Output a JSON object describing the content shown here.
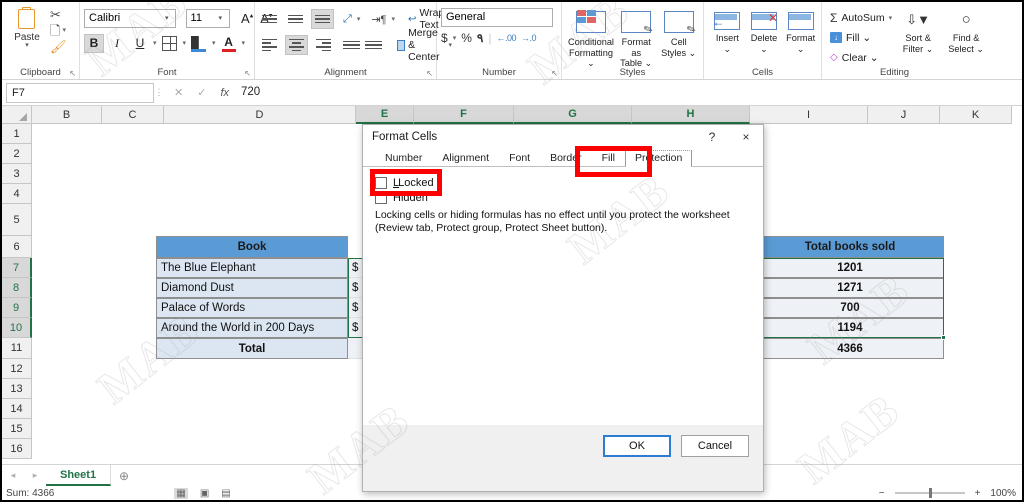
{
  "ribbon": {
    "clipboard": {
      "label": "Clipboard",
      "paste_label": "Paste",
      "paste_icon": "clipboard-icon",
      "cut_icon": "scissors-icon",
      "copy_icon": "copy-icon",
      "format_painter_icon": "format-painter-icon",
      "dialog_launcher": "↖"
    },
    "font": {
      "label": "Font",
      "font_name": "Calibri",
      "font_size": "11",
      "grow_font": "A",
      "shrink_font": "A",
      "bold": "B",
      "italic": "I",
      "underline": "U",
      "borders_icon": "borders-icon",
      "fill_color_icon": "fill-color-icon",
      "font_color_icon": "font-color-icon",
      "dialog_launcher": "↖"
    },
    "alignment": {
      "label": "Alignment",
      "wrap_text": "Wrap Text",
      "merge_center": "Merge & Center",
      "orientation_icon": "orientation-icon",
      "indent_icon": "indent-icon",
      "dialog_launcher": "↖"
    },
    "number": {
      "label": "Number",
      "format": "General",
      "currency": "$",
      "percent": "%",
      "comma": "٩",
      "increase_decimal": ".00",
      "decrease_decimal": ".0",
      "dialog_launcher": "↖"
    },
    "styles": {
      "label": "Styles",
      "items": [
        {
          "line1": "Conditional",
          "line2": "Formatting ⌄"
        },
        {
          "line1": "Format as",
          "line2": "Table ⌄"
        },
        {
          "line1": "Cell",
          "line2": "Styles ⌄"
        }
      ]
    },
    "cells": {
      "label": "Cells",
      "items": [
        {
          "line1": "Insert",
          "line2": "⌄"
        },
        {
          "line1": "Delete",
          "line2": "⌄"
        },
        {
          "line1": "Format",
          "line2": "⌄"
        }
      ]
    },
    "editing": {
      "label": "Editing",
      "autosum": "AutoSum",
      "fill": "Fill ⌄",
      "clear": "Clear ⌄",
      "sort_filter_l1": "Sort &",
      "sort_filter_l2": "Filter ⌄",
      "find_select_l1": "Find &",
      "find_select_l2": "Select ⌄"
    }
  },
  "formula_bar": {
    "name_box": "F7",
    "formula": "720",
    "cancel_icon": "cancel-icon",
    "enter_icon": "enter-icon",
    "function_icon": "fx"
  },
  "grid": {
    "column_headers": [
      "B",
      "C",
      "D",
      "E",
      "F",
      "G",
      "H",
      "I",
      "J",
      "K"
    ],
    "selected_columns": [
      "E",
      "F",
      "G",
      "H"
    ],
    "row_headers": [
      "1",
      "2",
      "3",
      "4",
      "5",
      "6",
      "7",
      "8",
      "9",
      "10",
      "11",
      "12",
      "13",
      "14",
      "15",
      "16"
    ],
    "selected_rows": [
      "7",
      "8",
      "9",
      "10"
    ],
    "table": {
      "header_book": "Book",
      "header_total": "Total books sold",
      "books": [
        "The Blue Elephant",
        "Diamond Dust",
        "Palace of Words",
        "Around the World in 200 Days"
      ],
      "total_label": "Total",
      "currency_marks": [
        "$",
        "$",
        "$",
        "$"
      ],
      "totals_sold": [
        "1201",
        "1271",
        "700",
        "1194"
      ],
      "grand_total_sold": "4366"
    }
  },
  "dialog": {
    "title": "Format Cells",
    "help_icon": "?",
    "close_icon": "×",
    "tabs": [
      "Number",
      "Alignment",
      "Font",
      "Border",
      "Fill",
      "Protection"
    ],
    "active_tab": "Protection",
    "locked_label": "Locked",
    "locked_checked": false,
    "hidden_label": "Hidden",
    "hidden_checked": false,
    "note": "Locking cells or hiding formulas has no effect until you protect the worksheet (Review tab, Protect group, Protect Sheet button).",
    "ok_label": "OK",
    "cancel_label": "Cancel"
  },
  "sheet_tabs": {
    "prev_icon": "◂",
    "next_icon": "▸",
    "tabs": [
      "Sheet1"
    ],
    "add_icon": "⊕"
  },
  "status_bar": {
    "summary": "Sum: 4366",
    "normal_view_icon": "normal-view-icon",
    "page_layout_icon": "page-layout-icon",
    "page_break_icon": "page-break-icon",
    "zoom_out": "−",
    "zoom_in": "+",
    "zoom_level": "100%"
  },
  "annotations": {
    "protection_tab_highlight": "red-rectangle",
    "locked_checkbox_highlight": "red-rectangle"
  },
  "watermark": {
    "text": "MAB"
  },
  "colors": {
    "table_header_blue": "#5B9BD5",
    "table_band_blue": "#DCE6F2",
    "excel_green": "#217346",
    "annotation_red": "#FF0000"
  }
}
